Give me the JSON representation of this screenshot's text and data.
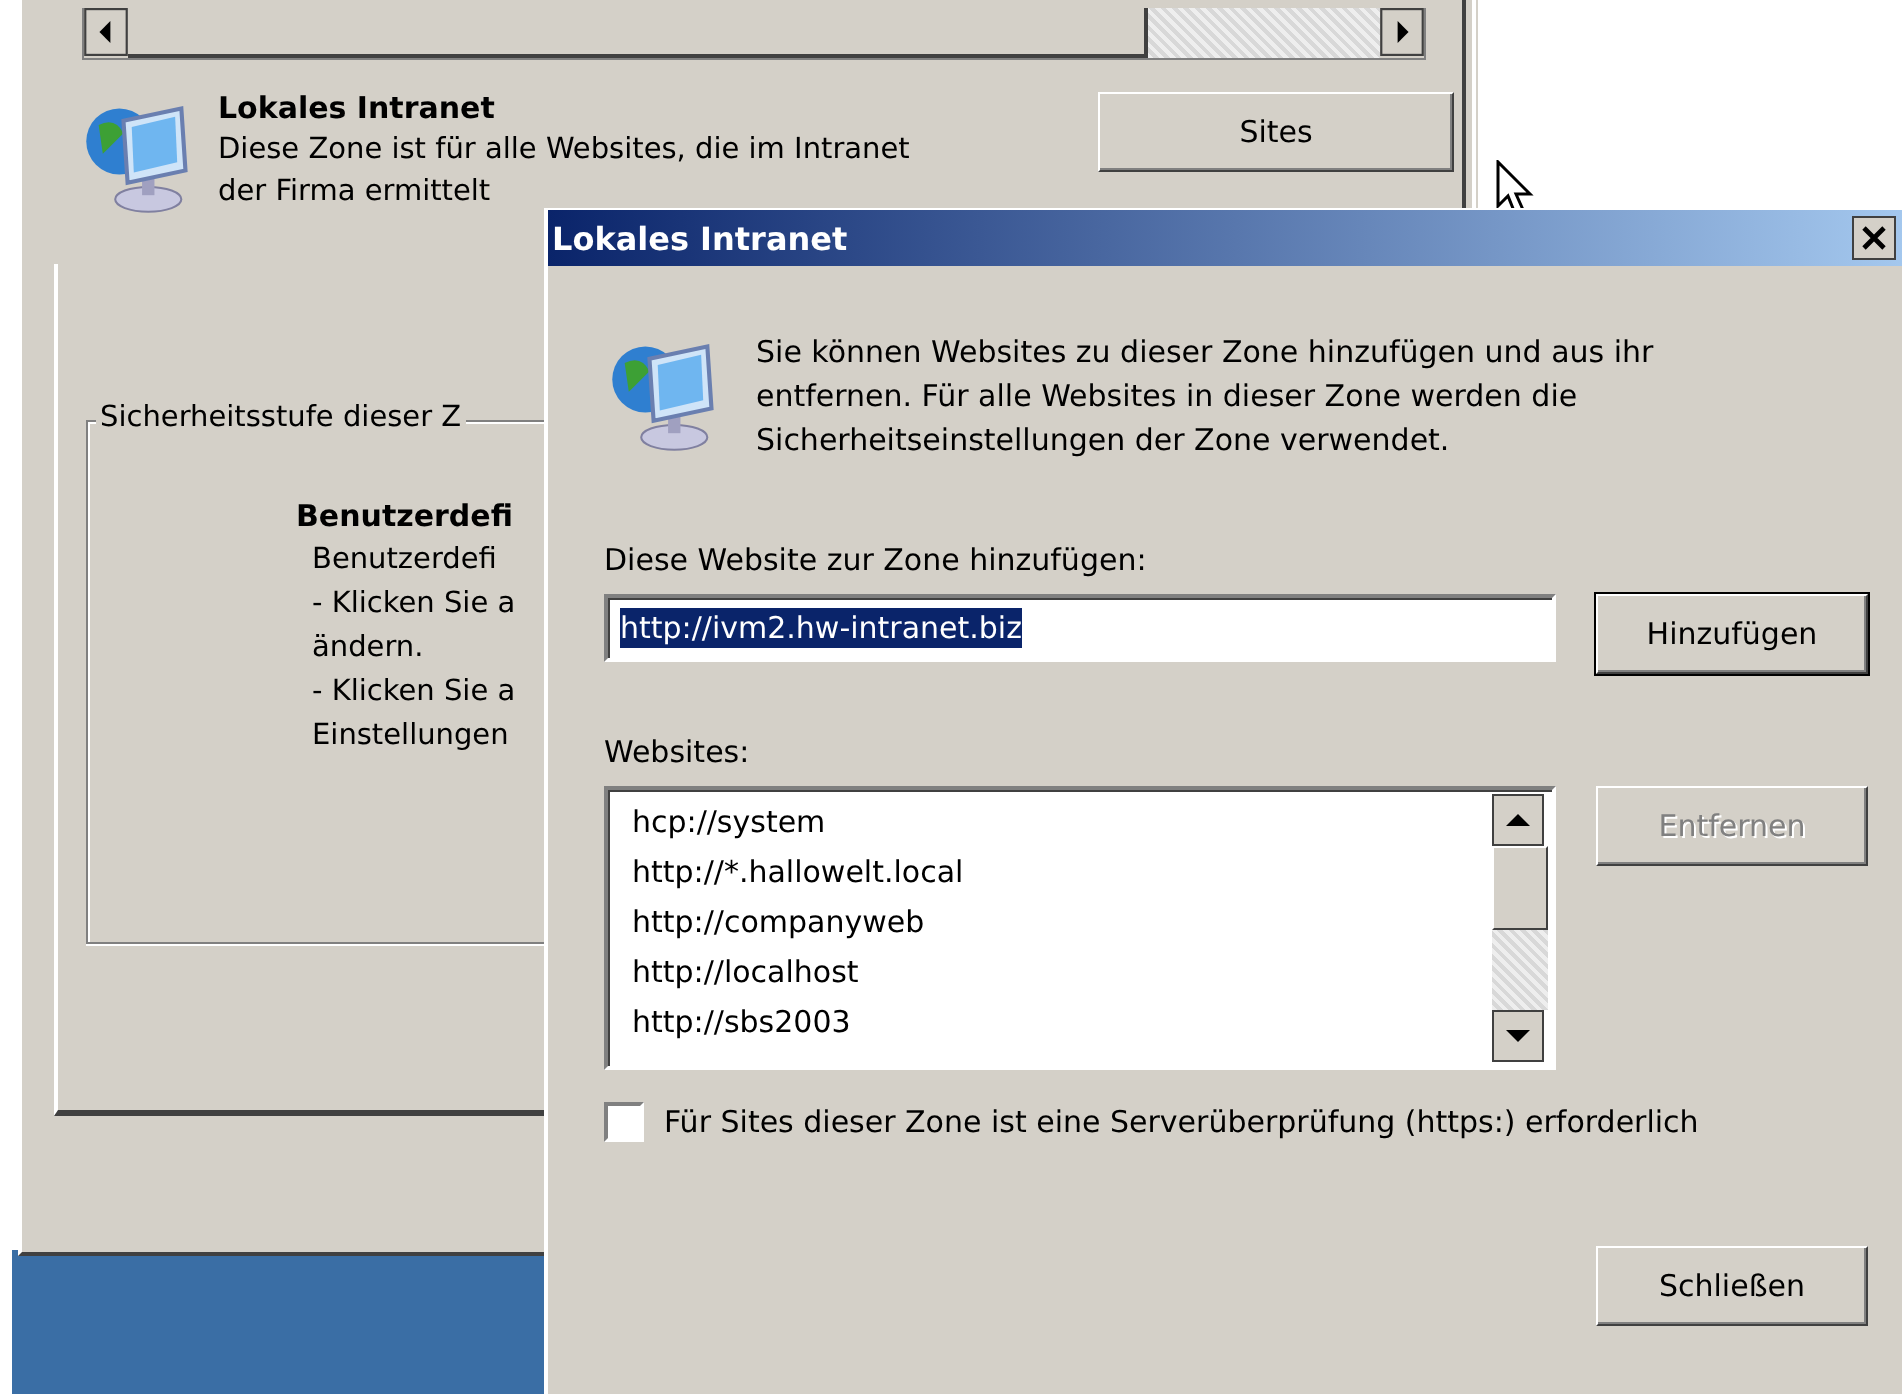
{
  "background_window": {
    "zone": {
      "name": "Lokales Intranet",
      "description_lines": [
        "Diese Zone ist für alle Websites, die im Intranet",
        "der Firma ermittelt"
      ]
    },
    "sites_button": "Sites",
    "security_group": {
      "label": "Sicherheitsstufe dieser Z",
      "level_title": "Benutzerdefi",
      "lines": [
        "Benutzerdefi",
        "- Klicken Sie a",
        "ändern.",
        "- Klicken Sie a",
        "Einstellungen"
      ]
    }
  },
  "dialog": {
    "title": "Lokales Intranet",
    "intro_lines": [
      "Sie können Websites zu dieser Zone hinzufügen und aus ihr",
      "entfernen. Für alle Websites in dieser Zone werden die",
      "Sicherheitseinstellungen der Zone verwendet."
    ],
    "add_label": "Diese Website zur Zone hinzufügen:",
    "add_field": {
      "value": "http://ivm2.hw-intranet.biz",
      "selected": true
    },
    "add_button": "Hinzufügen",
    "websites_label": "Websites:",
    "websites": [
      "hcp://system",
      "http://*.hallowelt.local",
      "http://companyweb",
      "http://localhost",
      "http://sbs2003"
    ],
    "remove_button": {
      "label": "Entfernen",
      "disabled": true
    },
    "https_check": {
      "label": "Für Sites dieser Zone ist eine Serverüberprüfung (https:) erforderlich",
      "checked": false
    },
    "close_button": "Schließen"
  }
}
